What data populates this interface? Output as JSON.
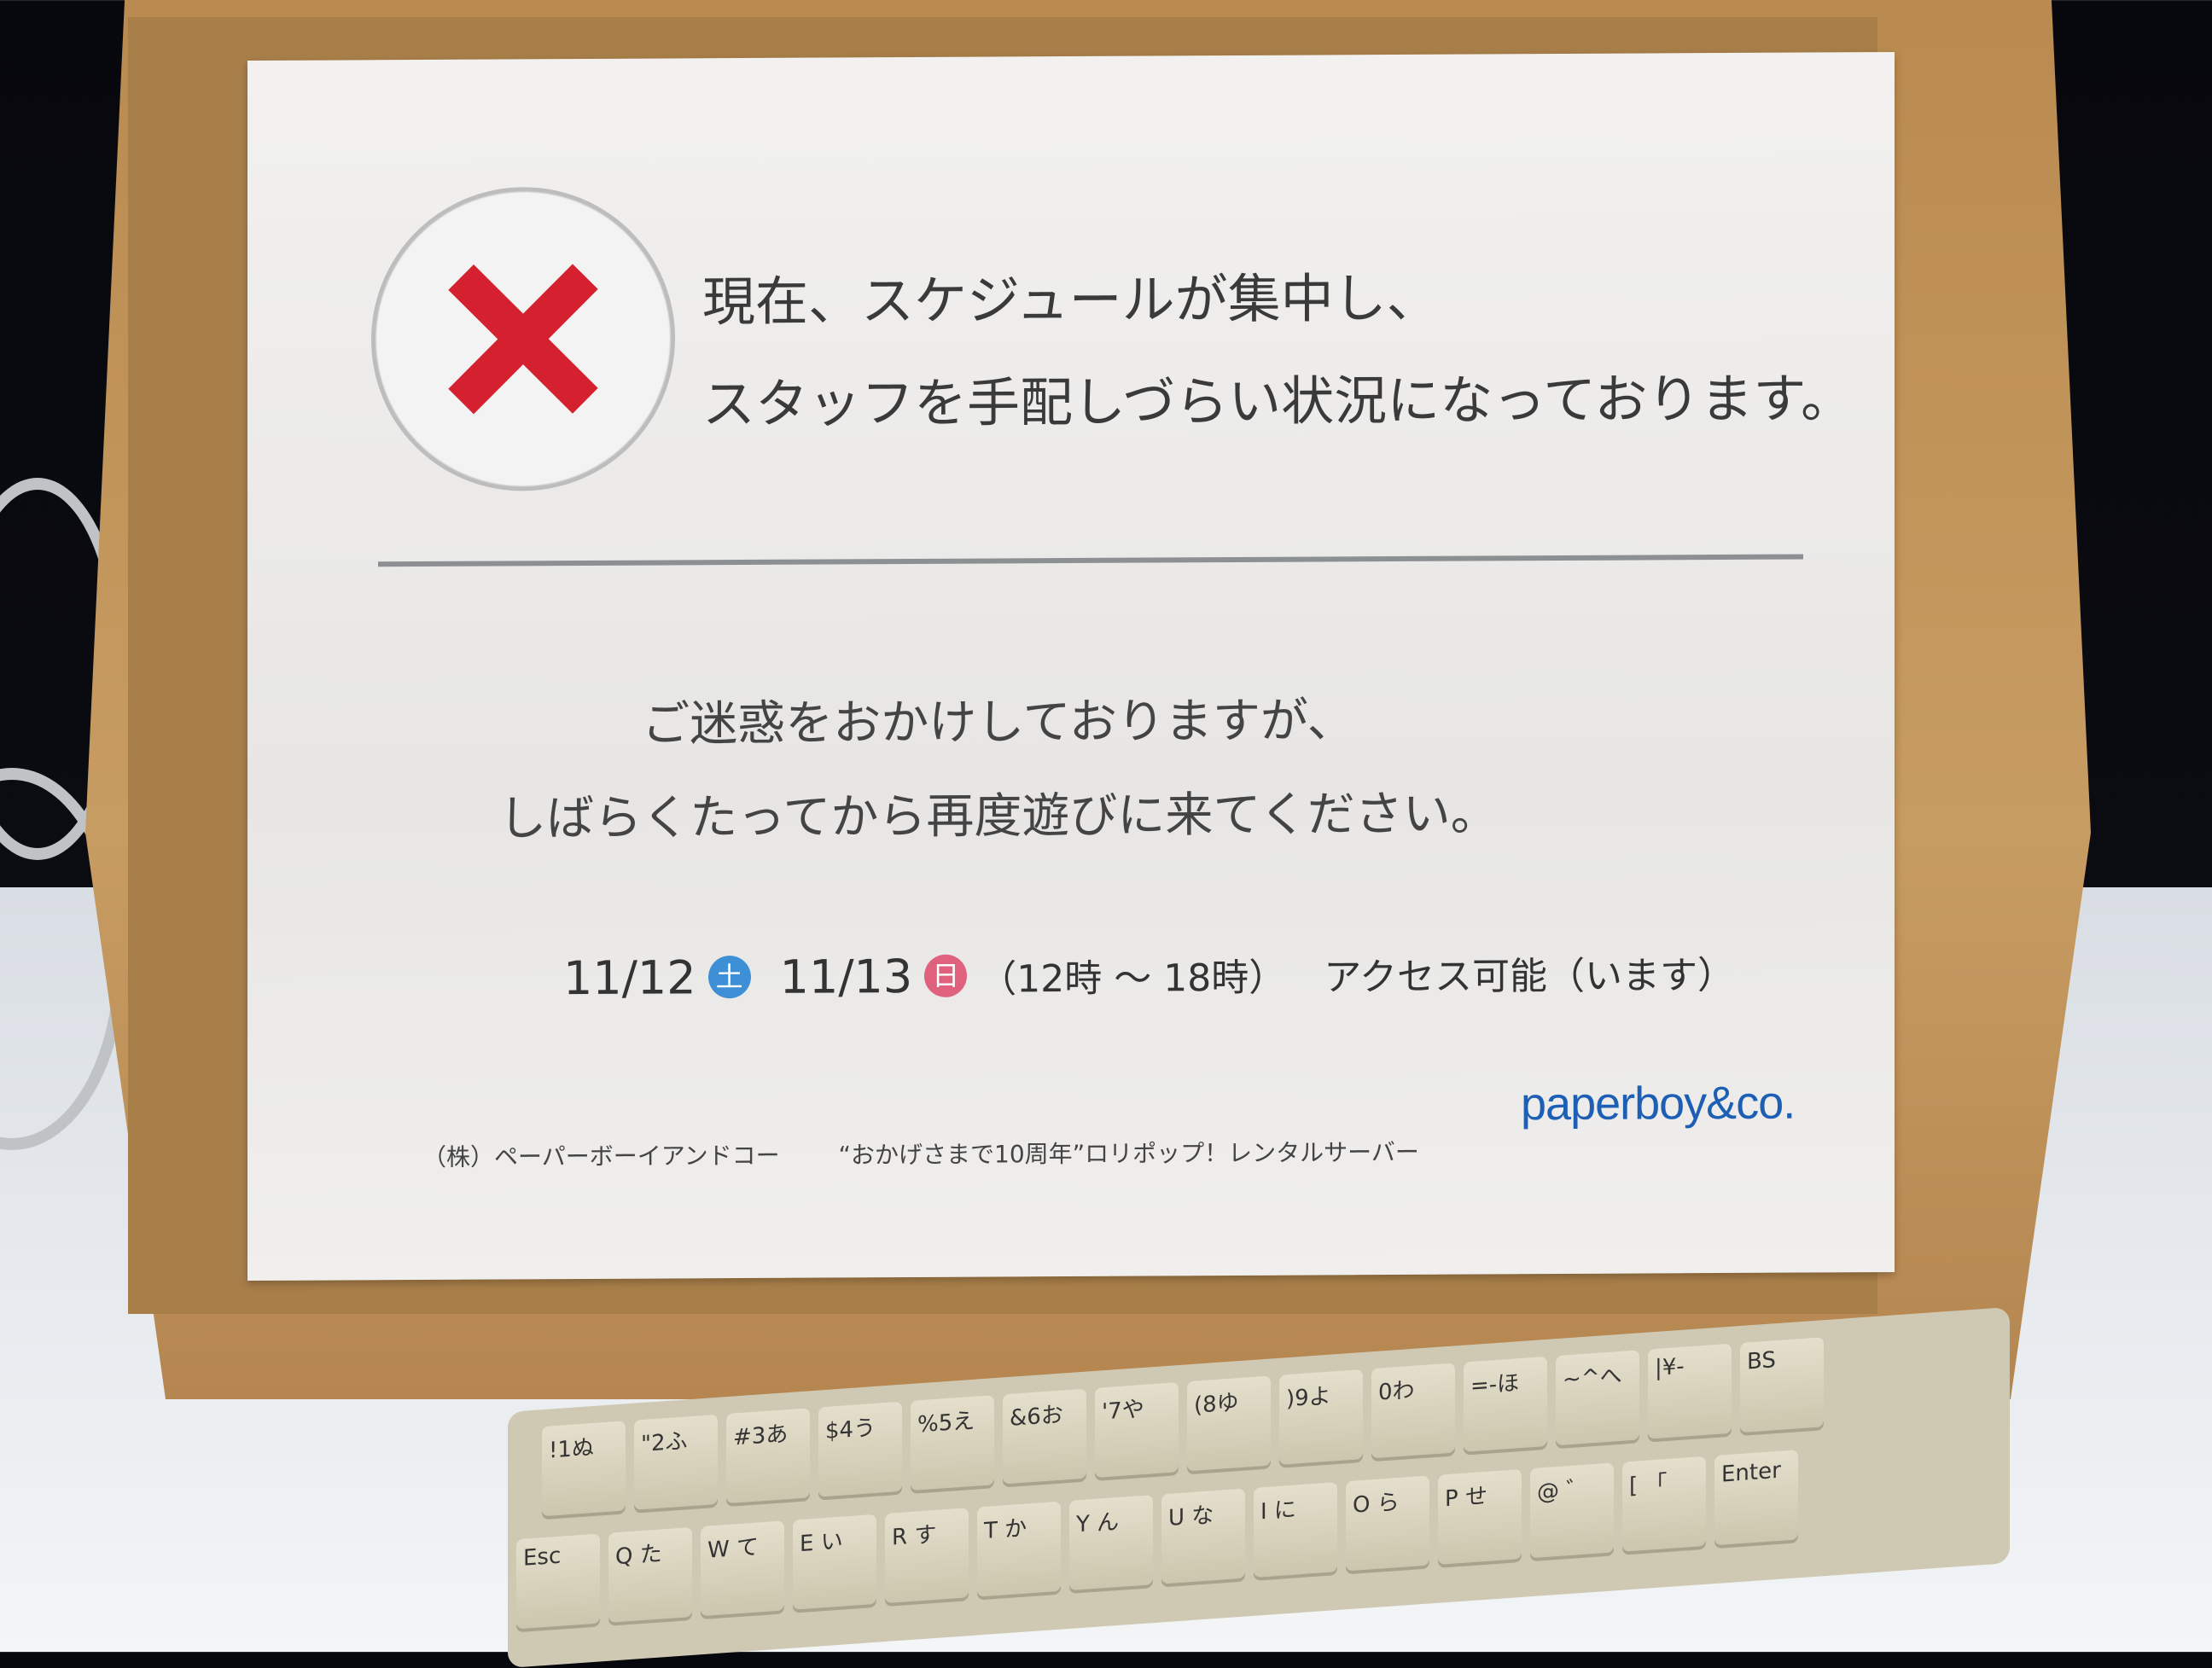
{
  "sign": {
    "headline": [
      "現在、スケジュールが集中し、",
      "スタッフを手配しづらい状況になっております。"
    ],
    "message": [
      "ご迷惑をおかけしておりますが、",
      "しばらくたってから再度遊びに来てください。"
    ],
    "date1": "11/12",
    "day1": "土",
    "date2": "11/13",
    "day2": "日",
    "hours": "（12時 ～ 18時）",
    "access": "アクセス可能（います）",
    "company": "（株）ペーパーボーイアンドコー",
    "tagline": "“おかげさまで10周年”ロリポップ！レンタルサーバー",
    "logo": "paperboy&co.",
    "colors": {
      "x_mark": "#d4202f",
      "sat": "#3d8fd6",
      "sun": "#e0617e",
      "logo": "#1d5fb5"
    }
  },
  "keyboard": {
    "row1": [
      "!1ぬ",
      "\"2ふ",
      "#3あ",
      "$4う",
      "%5え",
      "&6お",
      "'7や",
      "(8ゆ",
      ")9よ",
      "0わ",
      "=-ほ",
      "~^へ",
      "|¥-",
      "BS"
    ],
    "row2": [
      "Esc",
      "Q た",
      "W て",
      "E い",
      "R す",
      "T か",
      "Y ん",
      "U な",
      "I に",
      "O ら",
      "P せ",
      "@ ゛",
      "[ 「",
      "Enter"
    ]
  }
}
